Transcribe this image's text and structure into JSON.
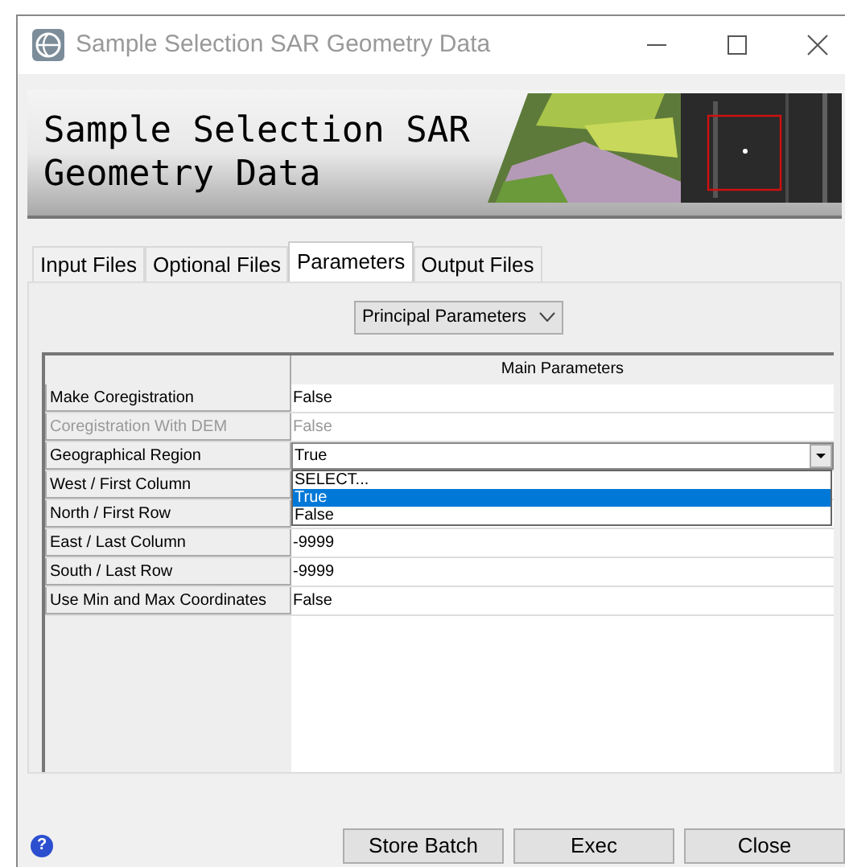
{
  "window": {
    "title": "Sample Selection SAR Geometry Data"
  },
  "banner": {
    "title": "Sample Selection SAR Geometry Data"
  },
  "tabs": [
    {
      "label": "Input Files",
      "selected": false
    },
    {
      "label": "Optional Files",
      "selected": false
    },
    {
      "label": "Parameters",
      "selected": true
    },
    {
      "label": "Output Files",
      "selected": false
    }
  ],
  "section_dropdown": {
    "value": "Principal Parameters"
  },
  "table": {
    "columns": [
      "Main Parameters"
    ],
    "rows": [
      {
        "label": "Make Coregistration",
        "value": "False",
        "disabled": false,
        "kind": "text"
      },
      {
        "label": "Coregistration With DEM",
        "value": "False",
        "disabled": true,
        "kind": "text"
      },
      {
        "label": "Geographical Region",
        "value": "True",
        "disabled": false,
        "kind": "dropdown",
        "expanded": true,
        "options": [
          {
            "label": "SELECT...",
            "selected": false
          },
          {
            "label": "True",
            "selected": true
          },
          {
            "label": "False",
            "selected": false
          }
        ]
      },
      {
        "label": "West / First Column",
        "disabled": false,
        "kind": "text"
      },
      {
        "label": "North / First Row",
        "disabled": false,
        "kind": "text"
      },
      {
        "label": "East / Last Column",
        "value": "-9999",
        "disabled": false,
        "kind": "text"
      },
      {
        "label": "South / Last Row",
        "value": "-9999",
        "disabled": false,
        "kind": "text"
      },
      {
        "label": "Use Min and Max Coordinates",
        "value": "False",
        "disabled": false,
        "kind": "text"
      }
    ]
  },
  "help_button": "?",
  "buttons": [
    "Store Batch",
    "Exec",
    "Close"
  ]
}
